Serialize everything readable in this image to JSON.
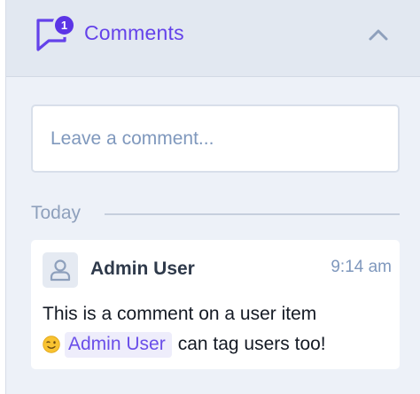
{
  "header": {
    "title": "Comments",
    "badge_count": "1",
    "icon": "comment-icon",
    "collapse_icon": "chevron-up-icon"
  },
  "input": {
    "placeholder": "Leave a comment...",
    "value": ""
  },
  "day_group": {
    "label": "Today"
  },
  "comment": {
    "author": "Admin User",
    "time": "9:14 am",
    "avatar_icon": "user-icon",
    "text_line1": "This is a comment on a user item",
    "emoji_icon": "winking-face-emoji",
    "mention": "Admin User",
    "text_after_mention": "can tag users too!"
  },
  "colors": {
    "accent": "#6442ea",
    "badge": "#5b35e6",
    "header_bg": "#e2e8f1",
    "panel_bg": "#edf1f8",
    "muted_text": "#7f98bd",
    "mention_bg": "#eeedfb"
  }
}
